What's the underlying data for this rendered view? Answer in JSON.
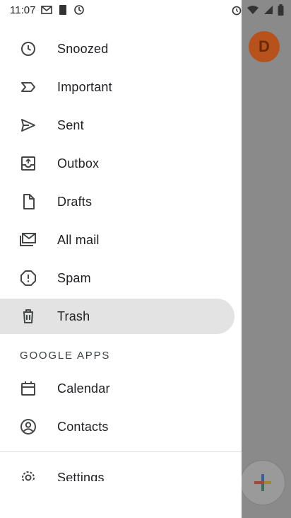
{
  "status_bar": {
    "time": "11:07"
  },
  "background": {
    "avatar_letter": "D"
  },
  "drawer": {
    "items": [
      {
        "label": "Snoozed",
        "icon": "clock-icon"
      },
      {
        "label": "Important",
        "icon": "important-icon"
      },
      {
        "label": "Sent",
        "icon": "send-icon"
      },
      {
        "label": "Outbox",
        "icon": "outbox-icon"
      },
      {
        "label": "Drafts",
        "icon": "draft-icon"
      },
      {
        "label": "All mail",
        "icon": "all-mail-icon"
      },
      {
        "label": "Spam",
        "icon": "spam-icon"
      },
      {
        "label": "Trash",
        "icon": "trash-icon",
        "selected": true
      }
    ],
    "section_header": "GOOGLE APPS",
    "apps": [
      {
        "label": "Calendar",
        "icon": "calendar-icon"
      },
      {
        "label": "Contacts",
        "icon": "contacts-icon"
      }
    ],
    "settings_label": "Settings"
  },
  "colors": {
    "drawer_bg": "#ffffff",
    "selected_bg": "#e3e3e3",
    "scrim": "#8a8a8a",
    "icon": "#444746"
  }
}
